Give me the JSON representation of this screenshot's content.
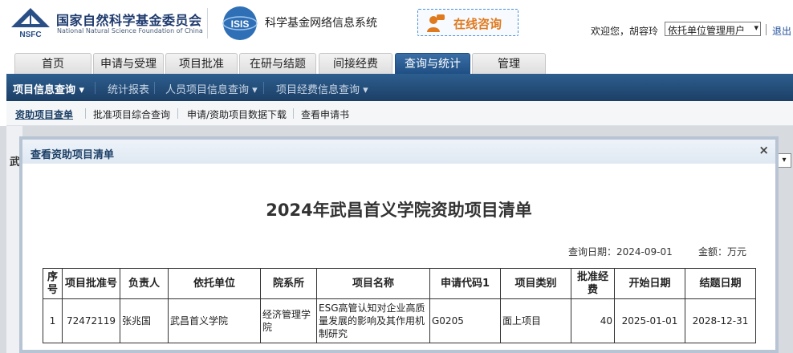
{
  "header": {
    "org_name_cn": "国家自然科学基金委员会",
    "org_name_en": "National Natural Science Foundation of China",
    "logo_text": "NSFC",
    "isis_logo_text": "ISIS",
    "system_name": "科学基金网络信息系统",
    "consult_label": "在线咨询",
    "welcome_text": "欢迎您，胡容玲",
    "role_select_value": "依托单位管理用户",
    "logout_label": "退出"
  },
  "tabs": [
    {
      "label": "首页"
    },
    {
      "label": "申请与受理"
    },
    {
      "label": "项目批准"
    },
    {
      "label": "在研与结题"
    },
    {
      "label": "间接经费"
    },
    {
      "label": "查询与统计",
      "active": true
    },
    {
      "label": "管理"
    }
  ],
  "menu": [
    {
      "label": "项目信息查询 ▾",
      "active": true
    },
    {
      "label": "统计报表"
    },
    {
      "label": "人员项目信息查询 ▾"
    },
    {
      "label": "项目经费信息查询 ▾"
    }
  ],
  "subnav": [
    {
      "label": "资助项目查单",
      "active": true
    },
    {
      "label": "批准项目综合查询"
    },
    {
      "label": "申请/资助项目数据下载"
    },
    {
      "label": "查看申请书"
    }
  ],
  "background": {
    "left_char": "武",
    "select_arrow": "▾"
  },
  "dialog": {
    "title": "查看资助项目清单",
    "close_symbol": "×",
    "report_title": "2024年武昌首义学院资助项目清单",
    "query_date": "查询日期：2024-09-01",
    "amount_unit": "金额：万元",
    "columns": [
      "序号",
      "项目批准号",
      "负责人",
      "依托单位",
      "院系所",
      "项目名称",
      "申请代码1",
      "项目类别",
      "批准经费",
      "开始日期",
      "结题日期"
    ],
    "rows": [
      [
        "1",
        "72472119",
        "张兆国",
        "武昌首义学院",
        "经济管理学院",
        "ESG高管认知对企业高质量发展的影响及其作用机制研究",
        "G0205",
        "面上项目",
        "40",
        "2025-01-01",
        "2028-12-31"
      ]
    ]
  },
  "colors": {
    "brand_blue": "#1c3f66",
    "tab_active": "#2d5e8f",
    "consult_orange": "#e07a1f"
  }
}
